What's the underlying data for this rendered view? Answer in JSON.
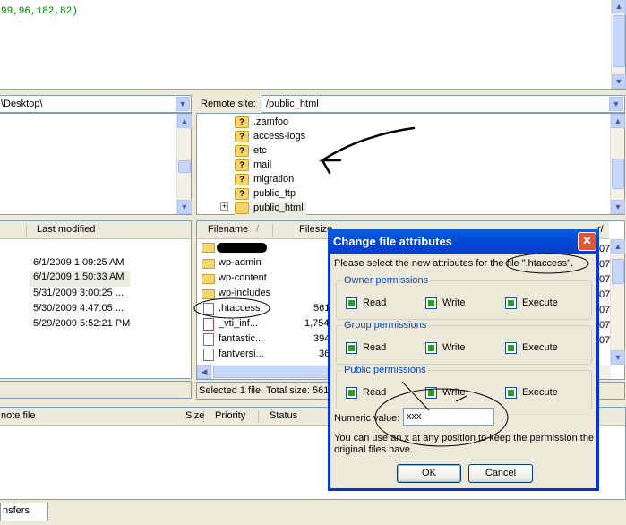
{
  "log": {
    "line": "99,96,182,82)"
  },
  "local": {
    "path": "\\Desktop\\"
  },
  "remote": {
    "label": "Remote site:",
    "path": "/public_html"
  },
  "tree": {
    "items": [
      ".zamfoo",
      "access-logs",
      "etc",
      "mail",
      "migration",
      "public_ftp",
      "public_html"
    ],
    "icon_mark": "?",
    "expander": "+"
  },
  "local_list": {
    "header_modified": "Last modified",
    "dates": [
      "6/1/2009 1:09:25 AM",
      "6/1/2009 1:50:33 AM",
      "5/31/2009 3:00:25 ...",
      "5/30/2009 4:47:05 ...",
      "5/29/2009 5:52:21 PM"
    ]
  },
  "remote_list": {
    "header_filename": "Filename",
    "sort_mark": "/",
    "header_filesize": "Filesize",
    "header_owner_partial": "r/",
    "files": [
      {
        "name": "",
        "size": ""
      },
      {
        "name": "wp-admin",
        "size": ""
      },
      {
        "name": "wp-content",
        "size": ""
      },
      {
        "name": "wp-includes",
        "size": ""
      },
      {
        "name": ".htaccess",
        "size": "561"
      },
      {
        "name": "_vti_inf...",
        "size": "1,754"
      },
      {
        "name": "fantastic...",
        "size": "394"
      },
      {
        "name": "fantversi...",
        "size": "36"
      }
    ],
    "row_suffix": "07",
    "status": "Selected 1 file. Total size: 561"
  },
  "queue": {
    "col_remote": "note file",
    "col_size": "Size",
    "col_priority": "Priority",
    "col_status": "Status"
  },
  "bottom_tab": "nsfers",
  "dialog": {
    "title": "Change file attributes",
    "close": "✕",
    "prompt": "Please select the new attributes for the file \".htaccess\".",
    "groups": [
      {
        "label": "Owner permissions",
        "read": "Read",
        "write": "Write",
        "execute": "Execute"
      },
      {
        "label": "Group permissions",
        "read": "Read",
        "write": "Write",
        "execute": "Execute"
      },
      {
        "label": "Public permissions",
        "read": "Read",
        "write": "Write",
        "execute": "Execute"
      }
    ],
    "numeric_label": "Numeric value:",
    "numeric_value": "xxx",
    "hint": "You can use an x at any position to keep the permission the original files have.",
    "ok": "OK",
    "cancel": "Cancel"
  },
  "colors": {
    "titlebar": "#0a5fdf",
    "highlight": "#ecebe2",
    "log_text": "#008000"
  },
  "scroll_arrows": {
    "up": "▲",
    "down": "▼",
    "left": "◀",
    "right": "▶"
  }
}
